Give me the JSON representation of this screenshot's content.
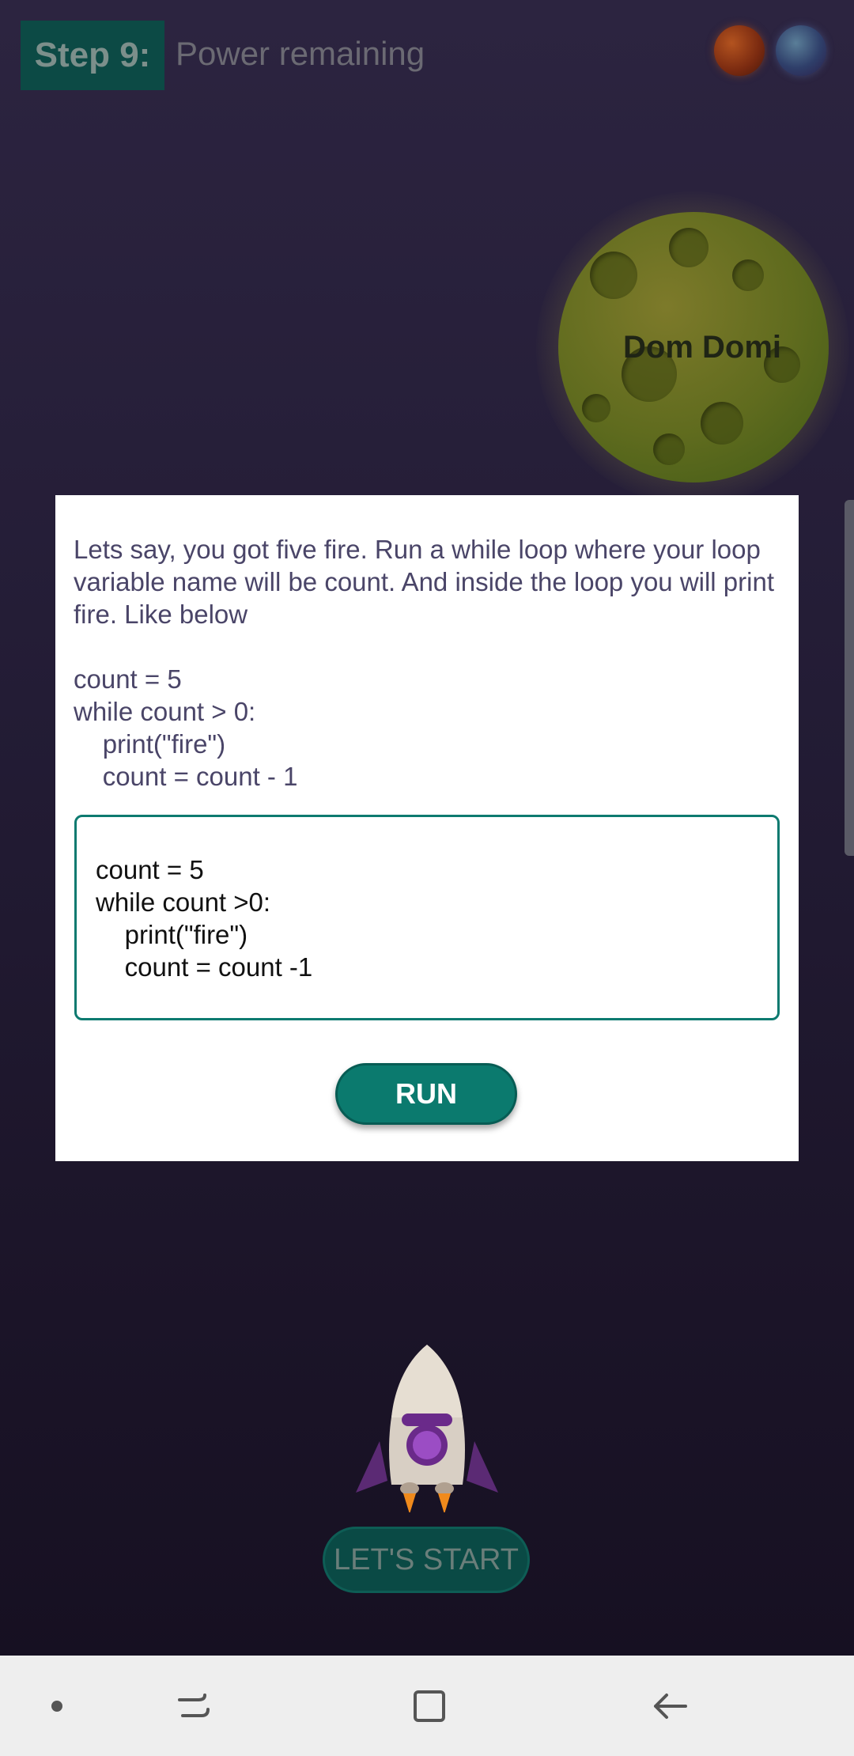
{
  "header": {
    "step_label": "Step 9:",
    "step_title": "Power remaining"
  },
  "planet": {
    "name": "Dom Domi"
  },
  "dialog": {
    "prompt": "Lets say, you got five fire. Run a while loop where your loop variable name will be count. And inside the loop you will print fire. Like below\n\ncount = 5\nwhile count > 0:\n    print(\"fire\")\n    count = count - 1",
    "code_input": "count = 5\nwhile count >0:\n    print(\"fire\")\n    count = count -1",
    "run_label": "RUN"
  },
  "start_button": {
    "label": "LET'S START"
  },
  "navbar": {
    "items": [
      "dot-icon",
      "recent-apps-icon",
      "home-icon",
      "back-icon"
    ]
  },
  "colors": {
    "accent": "#0b7a6e",
    "dialog_text": "#4a4568"
  }
}
